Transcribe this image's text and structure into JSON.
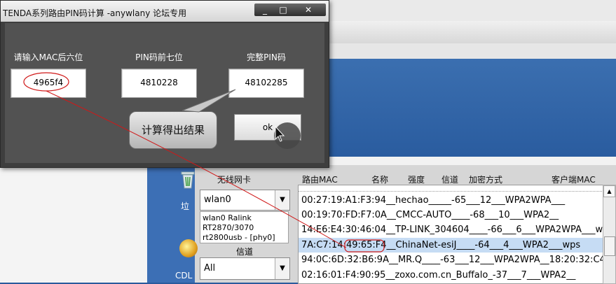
{
  "dialog": {
    "title": "TENDA系列路由PIN码计算 -anywlany 论坛专用",
    "controls": {
      "minimize": "_",
      "maximize": "□",
      "close": "✕"
    },
    "mac_label": "请输入MAC后六位",
    "mac_value": "4965f4",
    "pin7_label": "PIN码前七位",
    "pin7_value": "4810228",
    "pin_label": "完整PIN码",
    "pin_value": "48102285",
    "ok_label": "ok",
    "callout": "计算得出结果"
  },
  "desktop": {
    "bin_label": "垃",
    "cd_label": "CDL"
  },
  "scanner": {
    "headers": {
      "adapter": "无线网卡",
      "mac": "路由MAC",
      "name": "名称",
      "strength": "强度",
      "channel": "信道",
      "encryption": "加密方式",
      "client_mac": "客户端MAC"
    },
    "adapter_value": "wlan0",
    "adapter_info": [
      "wlan0 Ralink",
      "RT2870/3070",
      "rt2800usb - [phy0]"
    ],
    "channel_label": "信道",
    "channel_value": "All",
    "rows": [
      "00:27:19:A1:F3:94__hechao_____-65___12___WPA2WPA___",
      "00:19:70:FD:F7:0A__CMCC-AUTO____-68___10___WPA2__",
      "14:E6:E4:30:46:04__TP-LINK_304604____-66___6___WPA2WPA___w",
      "7A:C7:14:49:65:F4__ChinaNet-esiJ____-64___4___WPA2___wps",
      "94:0C:6D:32:B6:9A__MR.Q____-63___12___WPA2WPA__18:20:32:C4",
      "02:16:01:F4:90:95__zoxo.com.cn_Buffalo_-37___7___WPA2__"
    ],
    "selected_row": 3
  },
  "colors": {
    "annotation": "#d01818",
    "selection": "#c6dcf4",
    "desktop_blue": "#2a5c9f"
  }
}
